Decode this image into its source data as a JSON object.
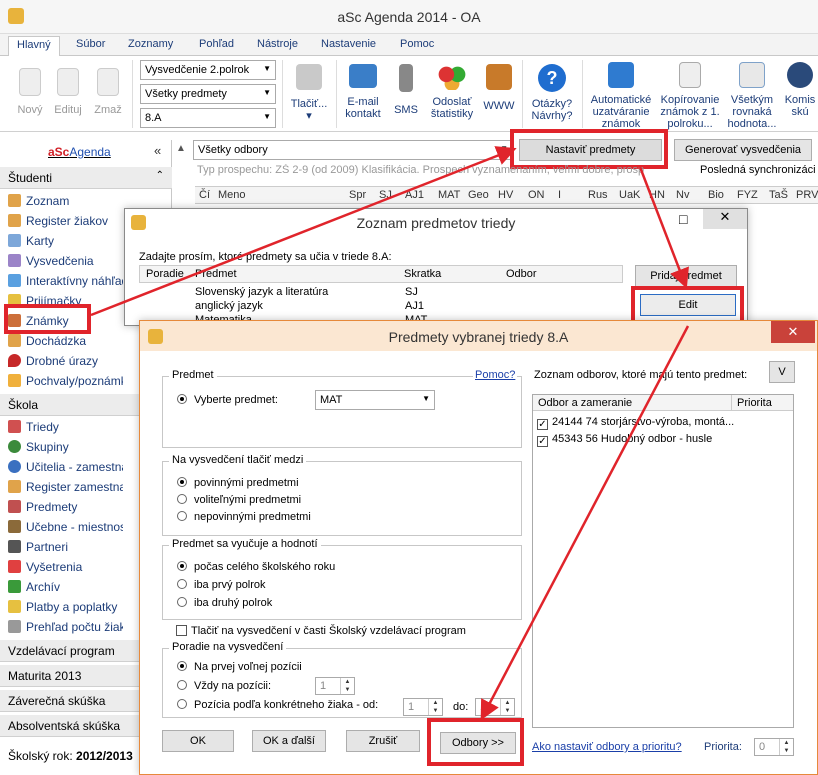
{
  "window": {
    "title": "aSc Agenda 2014 - OA"
  },
  "tabs": [
    "Hlavný",
    "Súbor",
    "Zoznamy",
    "Pohľad",
    "Nástroje",
    "Nastavenie",
    "Pomoc"
  ],
  "ribbon": {
    "new": "Nový",
    "edit": "Edituj",
    "delete": "Zmaž",
    "combo_report": "Vysvedčenie 2.polrok",
    "combo_subjects": "Všetky predmety",
    "combo_class": "8.A",
    "print": "Tlačiť...",
    "email": "E-mail kontakt",
    "sms": "SMS",
    "stats": "Odoslať štatistiky",
    "www": "WWW",
    "questions": "Otázky? Návrhy?",
    "setup_grades": "Automatické uzatváranie známok",
    "copy": "Kopírovanie známok z 1. polroku...",
    "all_uniform": "Všetkým rovnaká hodnota...",
    "komis": "Komis skú"
  },
  "toolbar": {
    "filter": "Všetky odbory",
    "set_subjects": "Nastaviť predmety",
    "generate": "Generovať vysvedčenia",
    "plan_text": "Typ prospechu: ZŠ 2-9 (od 2009) Klasifikácia. Prospech vyznamenaním, veľmi dobre, prosp",
    "last_sync": "Posledná synchronizáci"
  },
  "grid_headers": [
    "Čí",
    "Meno",
    "Spr",
    "SJ",
    "AJ1",
    "MAT",
    "Geo",
    "HV",
    "ON",
    "I",
    "Rus",
    "UaK",
    "HN",
    "Nv",
    "Bio",
    "FYZ",
    "TaŠ",
    "PRV"
  ],
  "sidebar": {
    "logo_brand": "aSc",
    "logo_rest": "Agenda",
    "collapse": "«",
    "section_students": "Študenti",
    "students": [
      "Zoznam",
      "Register žiakov",
      "Karty",
      "Vysvedčenia",
      "Interaktívny náhľad",
      "Prijímačky",
      "Známky",
      "Dochádzka",
      "Drobné úrazy",
      "Pochvaly/poznámky"
    ],
    "section_school": "Škola",
    "school": [
      "Triedy",
      "Skupiny",
      "Učitelia - zamestnanci",
      "Register zamestnancov",
      "Predmety",
      "Učebne - miestnosti",
      "Partneri",
      "Vyšetrenia",
      "Archív",
      "Platby a poplatky",
      "Prehľad počtu žiakov"
    ],
    "sections": [
      "Vzdelávací program",
      "Maturita 2013",
      "Záverečná skúška",
      "Absolventská skúška"
    ],
    "year_label": "Školský rok:",
    "year_value": "2012/2013"
  },
  "dialog1": {
    "title": "Zoznam predmetov triedy",
    "prompt": "Zadajte prosím, ktoré predmety sa učia v triede 8.A:",
    "cols": [
      "Poradie",
      "Predmet",
      "Skratka",
      "Odbor"
    ],
    "rows": [
      [
        "Slovenský jazyk a literatúra",
        "SJ"
      ],
      [
        "anglický jazyk",
        "AJ1"
      ],
      [
        "Matematika",
        "MAT"
      ]
    ],
    "add": "Pridaj predmet",
    "edit": "Edit"
  },
  "dialog2": {
    "title": "Predmety vybranej triedy 8.A",
    "grp_subject": "Predmet",
    "help": "Pomoc?",
    "choose": "Vyberte predmet:",
    "subject_value": "MAT",
    "grp_print": "Na vysvedčení tlačiť medzi",
    "print_opts": [
      "povinnými predmetmi",
      "voliteľnými predmetmi",
      "nepovinnými predmetmi"
    ],
    "grp_taught": "Predmet sa vyučuje a hodnotí",
    "taught_opts": [
      "počas celého školského roku",
      "iba prvý polrok",
      "iba druhý polrok"
    ],
    "print_svp": "Tlačiť na vysvedčení v časti Školský vzdelávací program",
    "grp_order": "Poradie na vysvedčení",
    "order_opts": [
      "Na prvej voľnej pozícii",
      "Vždy na pozícii:",
      "Pozícia podľa konkrétneho žiaka - od:"
    ],
    "pos_value": "1",
    "from_value": "1",
    "to_label": "do:",
    "to_value": "1",
    "fields_label": "Zoznam odborov, ktoré majú tento predmet:",
    "v_btn": "V",
    "fields_cols": [
      "Odbor a zameranie",
      "Priorita"
    ],
    "fields": [
      "24144 74 storjárstvo-výroba, montá...",
      "45343 56 Hudobný odbor - husle"
    ],
    "ok": "OK",
    "ok_next": "OK a ďalší",
    "cancel": "Zrušiť",
    "fields_btn": "Odbory >>",
    "how_link": "Ako nastaviť odbory a prioritu?",
    "priority_label": "Priorita:",
    "priority_value": "0"
  }
}
